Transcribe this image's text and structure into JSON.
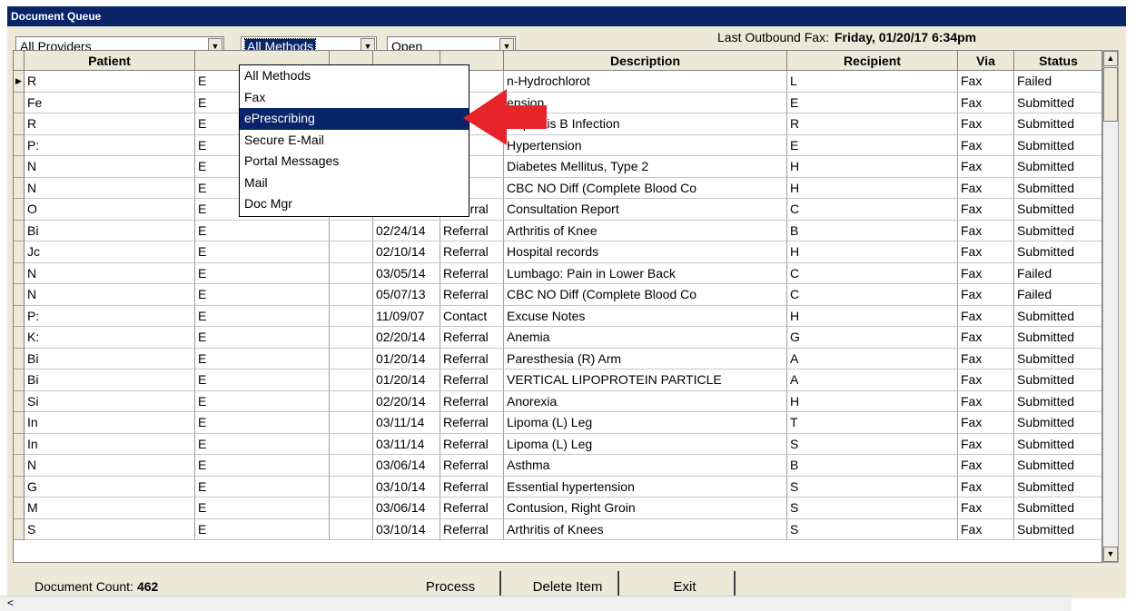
{
  "window": {
    "title": "Document Queue"
  },
  "filters": {
    "providers": "All Providers",
    "methods": "All Methods",
    "status": "Open"
  },
  "last_fax": {
    "label": "Last Outbound Fax:",
    "value": "Friday, 01/20/17   6:34pm"
  },
  "columns": [
    "Patient",
    "",
    "",
    "",
    "Description",
    "Recipient",
    "Via",
    "Status"
  ],
  "rows": [
    [
      "R",
      "E",
      "",
      "",
      "",
      "n-Hydrochlorot",
      "L",
      "Fax",
      "Failed"
    ],
    [
      "Fe",
      "E",
      "",
      "",
      "",
      "ension",
      "E",
      "Fax",
      "Submitted"
    ],
    [
      "R",
      "E",
      "",
      "",
      "al",
      "Hepatitis B Infection",
      "R",
      "Fax",
      "Submitted"
    ],
    [
      "P:",
      "E",
      "",
      "",
      "al",
      "Hypertension",
      "E",
      "Fax",
      "Submitted"
    ],
    [
      "N",
      "E",
      "",
      "",
      "al",
      "Diabetes Mellitus, Type 2",
      "H",
      "Fax",
      "Submitted"
    ],
    [
      "N",
      "E",
      "",
      "",
      "",
      "CBC NO Diff (Complete Blood Co",
      "H",
      "Fax",
      "Submitted"
    ],
    [
      "O",
      "E",
      "",
      "02/24/14",
      "Referral",
      "Consultation Report",
      "C",
      "Fax",
      "Submitted"
    ],
    [
      "Bi",
      "E",
      "",
      "02/24/14",
      "Referral",
      "Arthritis of Knee",
      "B",
      "Fax",
      "Submitted"
    ],
    [
      "Jc",
      "E",
      "",
      "02/10/14",
      "Referral",
      "Hospital records",
      "H",
      "Fax",
      "Submitted"
    ],
    [
      "N",
      "E",
      "",
      "03/05/14",
      "Referral",
      "Lumbago: Pain in Lower Back",
      "C",
      "Fax",
      "Failed"
    ],
    [
      "N",
      "E",
      "",
      "05/07/13",
      "Referral",
      "CBC NO Diff (Complete Blood Co",
      "C",
      "Fax",
      "Failed"
    ],
    [
      "P:",
      "E",
      "",
      "11/09/07",
      "Contact",
      "Excuse Notes",
      "H",
      "Fax",
      "Submitted"
    ],
    [
      "K:",
      "E",
      "",
      "02/20/14",
      "Referral",
      "Anemia",
      "G",
      "Fax",
      "Submitted"
    ],
    [
      "Bi",
      "E",
      "",
      "01/20/14",
      "Referral",
      "Paresthesia (R) Arm",
      "A",
      "Fax",
      "Submitted"
    ],
    [
      "Bi",
      "E",
      "",
      "01/20/14",
      "Referral",
      "VERTICAL LIPOPROTEIN PARTICLE",
      "A",
      "Fax",
      "Submitted"
    ],
    [
      "Si",
      "E",
      "",
      "02/20/14",
      "Referral",
      "Anorexia",
      "H",
      "Fax",
      "Submitted"
    ],
    [
      "In",
      "E",
      "",
      "03/11/14",
      "Referral",
      "Lipoma (L) Leg",
      "T",
      "Fax",
      "Submitted"
    ],
    [
      "In",
      "E",
      "",
      "03/11/14",
      "Referral",
      "Lipoma (L) Leg",
      "S",
      "Fax",
      "Submitted"
    ],
    [
      "N",
      "E",
      "",
      "03/06/14",
      "Referral",
      "Asthma",
      "B",
      "Fax",
      "Submitted"
    ],
    [
      "G",
      "E",
      "",
      "03/10/14",
      "Referral",
      "Essential hypertension",
      "S",
      "Fax",
      "Submitted"
    ],
    [
      "M",
      "E",
      "",
      "03/06/14",
      "Referral",
      "Contusion, Right Groin",
      "S",
      "Fax",
      "Submitted"
    ],
    [
      "S",
      "E",
      "",
      "03/10/14",
      "Referral",
      "Arthritis of Knees",
      "S",
      "Fax",
      "Submitted"
    ]
  ],
  "dropdown": {
    "items": [
      "All Methods",
      "Fax",
      "ePrescribing",
      "Secure E-Mail",
      "Portal Messages",
      "Mail",
      "Doc Mgr"
    ],
    "highlighted": 2
  },
  "footer": {
    "count_label": "Document Count:",
    "count_value": "462",
    "buttons": [
      "Process",
      "Delete Item",
      "Exit"
    ]
  },
  "icons": {
    "dropdown_arrow": "triangle-down",
    "row_pointer": "triangle-right",
    "scroll_up": "triangle-up",
    "scroll_down": "triangle-down",
    "scroll_left": "chevron-left"
  },
  "colors": {
    "titlebar": "#0a246a",
    "selection": "#0a246a",
    "annotation_arrow": "#e8242b"
  }
}
